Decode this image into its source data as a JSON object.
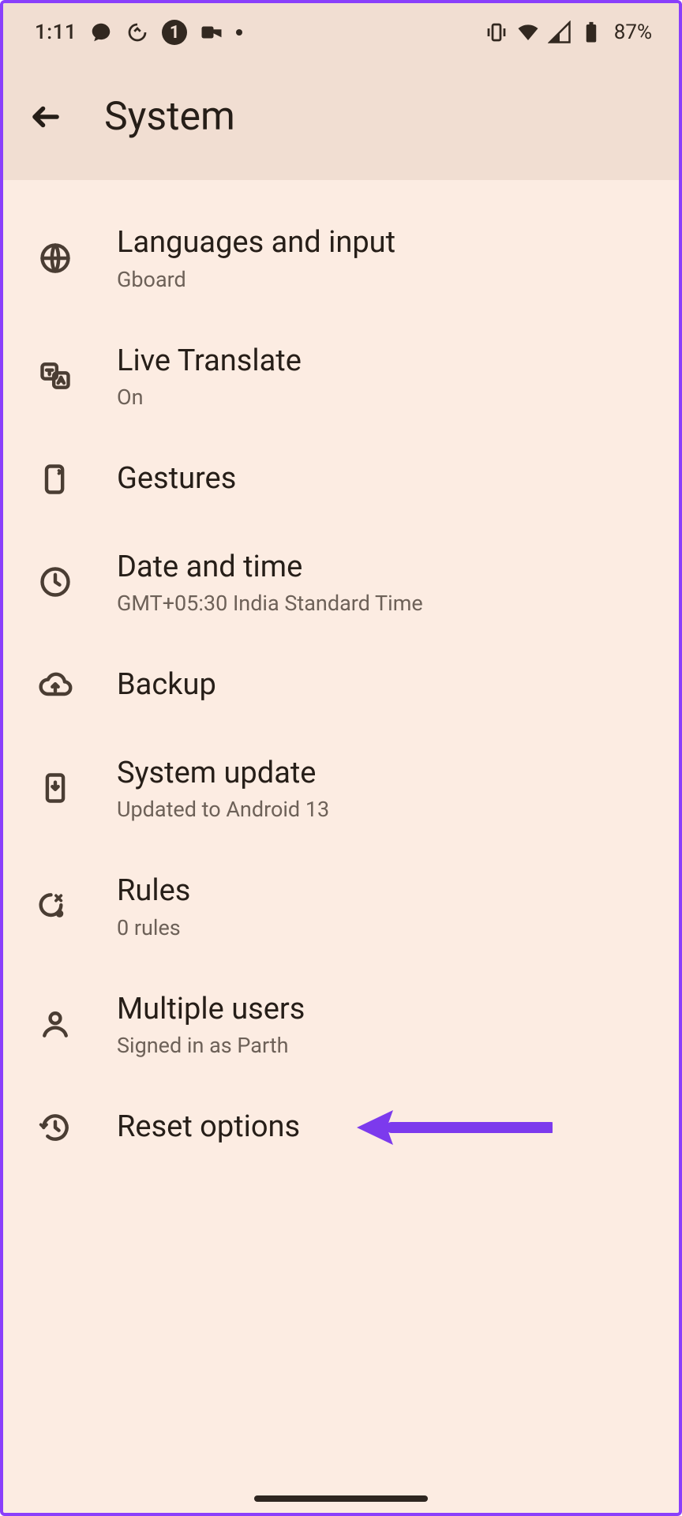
{
  "status": {
    "time": "1:11",
    "notification_count": "1",
    "battery_text": "87%"
  },
  "header": {
    "title": "System"
  },
  "items": [
    {
      "icon": "globe",
      "title": "Languages and input",
      "subtitle": "Gboard"
    },
    {
      "icon": "translate",
      "title": "Live Translate",
      "subtitle": "On"
    },
    {
      "icon": "gesture",
      "title": "Gestures",
      "subtitle": ""
    },
    {
      "icon": "clock",
      "title": "Date and time",
      "subtitle": "GMT+05:30 India Standard Time"
    },
    {
      "icon": "cloud-upload",
      "title": "Backup",
      "subtitle": ""
    },
    {
      "icon": "phone-update",
      "title": "System update",
      "subtitle": "Updated to Android 13"
    },
    {
      "icon": "rules",
      "title": "Rules",
      "subtitle": "0 rules"
    },
    {
      "icon": "person",
      "title": "Multiple users",
      "subtitle": "Signed in as Parth"
    },
    {
      "icon": "history",
      "title": "Reset options",
      "subtitle": ""
    }
  ],
  "annotation": {
    "target_index": 8
  }
}
